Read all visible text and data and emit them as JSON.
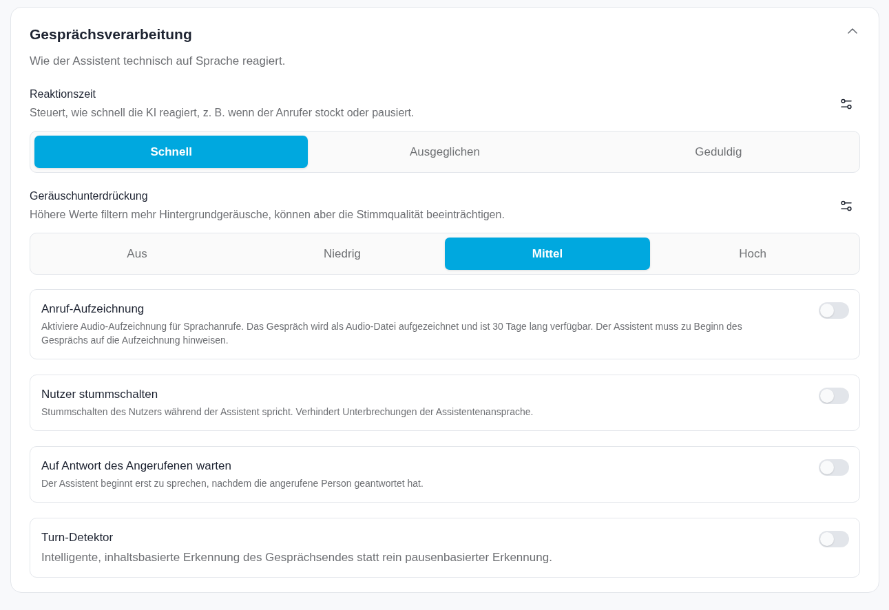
{
  "section": {
    "title": "Gesprächsverarbeitung",
    "expanded": true,
    "description": "Wie der Assistent technisch auf Sprache reagiert."
  },
  "settings": [
    {
      "label": "Reaktionszeit",
      "description": "Steuert, wie schnell die KI reagiert, z. B. wenn der Anrufer stockt oder pausiert.",
      "options": [
        {
          "label": "Schnell",
          "selected": true
        },
        {
          "label": "Ausgeglichen",
          "selected": false
        },
        {
          "label": "Geduldig",
          "selected": false
        }
      ]
    },
    {
      "label": "Geräuschunterdrückung",
      "description": "Höhere Werte filtern mehr Hintergrundgeräusche, können aber die Stimmqualität beeinträchtigen.",
      "options": [
        {
          "label": "Aus",
          "selected": false
        },
        {
          "label": "Niedrig",
          "selected": false
        },
        {
          "label": "Mittel",
          "selected": true
        },
        {
          "label": "Hoch",
          "selected": false
        }
      ]
    }
  ],
  "toggles": [
    {
      "title": "Anruf-Aufzeichnung",
      "description": "Aktiviere Audio-Aufzeichnung für Sprachanrufe. Das Gespräch wird als Audio-Datei aufgezeichnet und ist 30 Tage lang verfügbar. Der Assistent muss zu Beginn des Gesprächs auf die Aufzeichnung hinweisen.",
      "on": false
    },
    {
      "title": "Nutzer stummschalten",
      "description": "Stummschalten des Nutzers während der Assistent spricht. Verhindert Unterbrechungen der Assistentenansprache.",
      "on": false
    },
    {
      "title": "Auf Antwort des Angerufenen warten",
      "description": "Der Assistent beginnt erst zu sprechen, nachdem die angerufene Person geantwortet hat.",
      "on": false
    },
    {
      "title": "Turn-Detektor",
      "description": "Intelligente, inhaltsbasierte Erkennung des Gesprächsendes statt rein pausenbasierter Erkennung.",
      "on": false
    }
  ]
}
